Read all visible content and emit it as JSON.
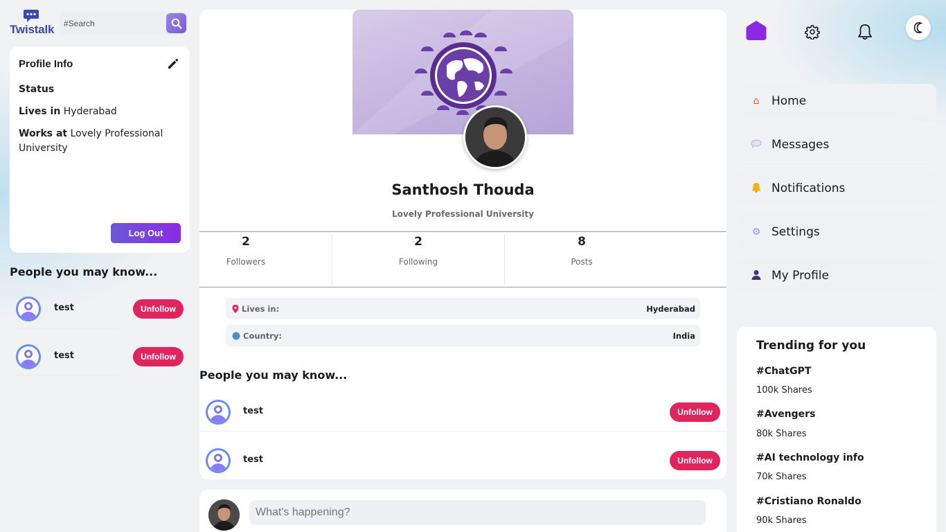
{
  "app": {
    "name": "Twistalk"
  },
  "search": {
    "placeholder": "#Search"
  },
  "profile_info": {
    "title": "Profile Info",
    "status_label": "Status",
    "lives_label": "Lives in",
    "lives_value": "Hyderabad",
    "works_label": "Works at",
    "works_value": "Lovely Professional University",
    "logout_label": "Log Out"
  },
  "left_people": {
    "title": "People you may know...",
    "items": [
      {
        "name": "test",
        "action": "Unfollow"
      },
      {
        "name": "test",
        "action": "Unfollow"
      }
    ]
  },
  "profile": {
    "name": "Santhosh Thouda",
    "org": "Lovely Professional University",
    "stats": [
      {
        "value": "2",
        "label": "Followers"
      },
      {
        "value": "2",
        "label": "Following"
      },
      {
        "value": "8",
        "label": "Posts"
      }
    ],
    "details": [
      {
        "icon": "pin-icon",
        "label": "Lives in:",
        "value": "Hyderabad"
      },
      {
        "icon": "globe-icon",
        "label": "Country:",
        "value": "India"
      }
    ]
  },
  "center_people": {
    "title": "People you may know...",
    "items": [
      {
        "name": "test",
        "action": "Unfollow"
      },
      {
        "name": "test",
        "action": "Unfollow"
      }
    ]
  },
  "composer": {
    "placeholder": "What's happening?"
  },
  "nav": {
    "items": [
      {
        "icon": "house-icon",
        "glyph": "🏠",
        "label": "Home"
      },
      {
        "icon": "speech-bubble-icon",
        "glyph": "💭",
        "label": "Messages"
      },
      {
        "icon": "bell-icon",
        "glyph": "🔔",
        "label": "Notifications"
      },
      {
        "icon": "gear-icon",
        "glyph": "⚙",
        "label": "Settings"
      },
      {
        "icon": "user-icon",
        "glyph": "👤",
        "label": "My Profile"
      }
    ]
  },
  "trending": {
    "title": "Trending for you",
    "items": [
      {
        "tag": "#ChatGPT",
        "count": "100k Shares"
      },
      {
        "tag": "#Avengers",
        "count": "80k Shares"
      },
      {
        "tag": "#AI technology info",
        "count": "70k Shares"
      },
      {
        "tag": "#Cristiano Ronaldo",
        "count": "90k Shares"
      }
    ]
  },
  "colors": {
    "brand": "#3949ab",
    "accent": "#7a5cd8",
    "unfollow": "#e0245e"
  }
}
